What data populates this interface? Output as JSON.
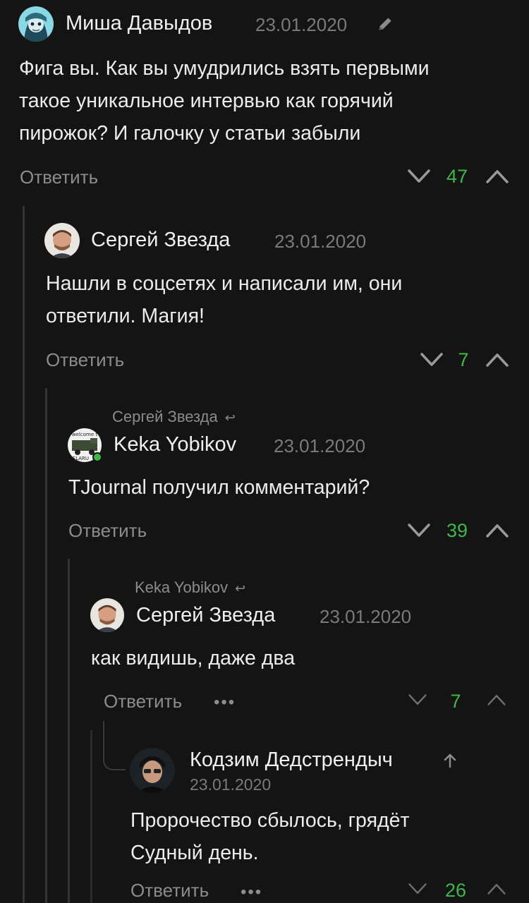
{
  "comments": [
    {
      "author": "Миша Давыдов",
      "date": "23.01.2020",
      "lines": [
        "Фига вы. Как вы умудрились взять первыми",
        "такое уникальное интервью как горячий",
        "пирожок? И галочку у статьи забыли"
      ],
      "reply_label": "Ответить",
      "score": "47"
    },
    {
      "author": "Сергей Звезда",
      "date": "23.01.2020",
      "lines": [
        "Нашли в соцсетях и написали им, они",
        "ответили. Магия!"
      ],
      "reply_label": "Ответить",
      "score": "7"
    },
    {
      "reply_to": "Сергей Звезда",
      "author": "Keka Yobikov",
      "date": "23.01.2020",
      "avatar_text_top": "welcome t",
      "avatar_text_bottom": "BELARU",
      "lines": [
        "TJournal получил комментарий?"
      ],
      "reply_label": "Ответить",
      "score": "39"
    },
    {
      "reply_to": "Keka Yobikov",
      "author": "Сергей Звезда",
      "date": "23.01.2020",
      "lines": [
        "как видишь, даже два"
      ],
      "reply_label": "Ответить",
      "more": "•••",
      "score": "7"
    },
    {
      "author": "Кодзим Дедстрендыч",
      "date": "23.01.2020",
      "lines": [
        "Пророчество сбылось, грядёт",
        "Судный день."
      ],
      "reply_label": "Ответить",
      "more": "•••",
      "score": "26"
    }
  ],
  "icons": {
    "reply_to_arrow": "↩",
    "edit": "pencil-icon",
    "upvote": "chevron-up-icon",
    "downvote": "chevron-down-icon"
  },
  "colors": {
    "background": "#141414",
    "score_positive": "#3fb64a",
    "muted": "#8c8c8c"
  }
}
